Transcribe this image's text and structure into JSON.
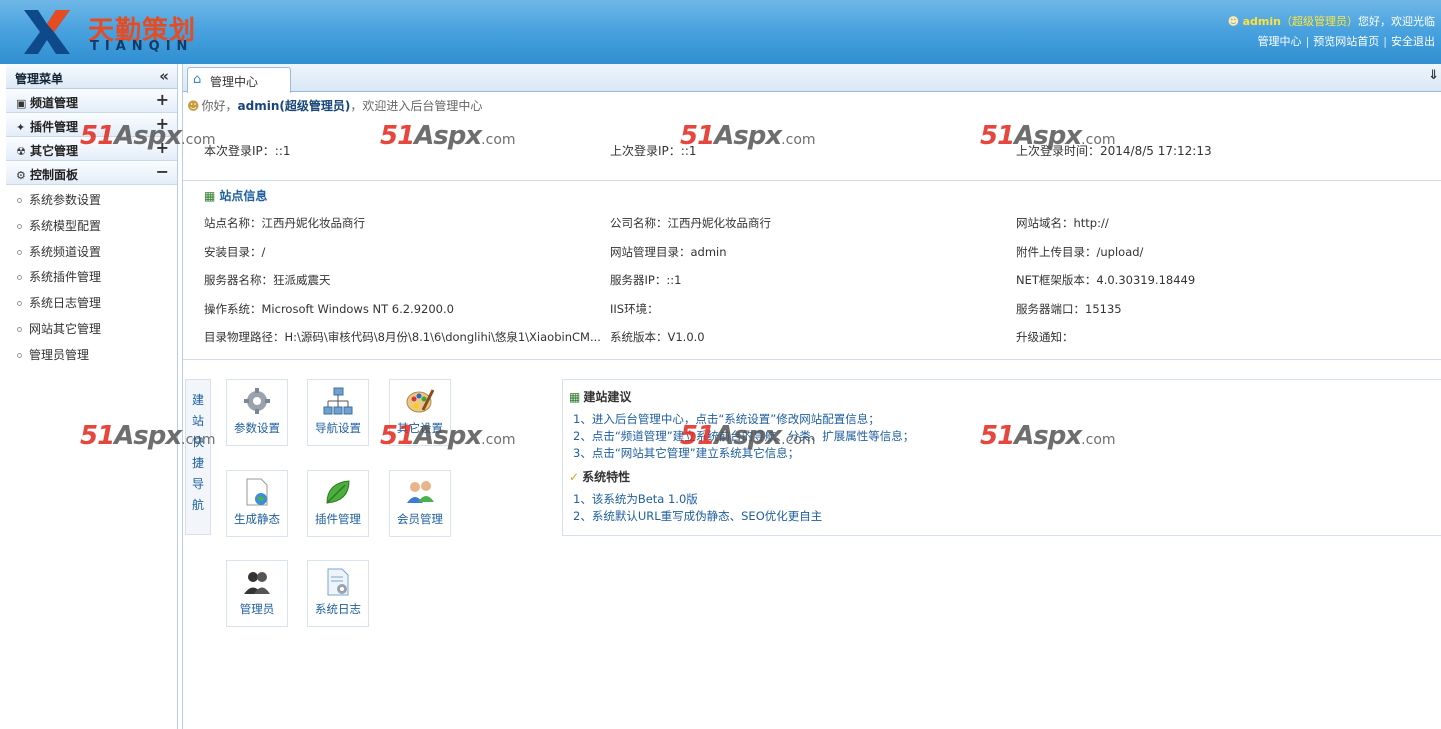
{
  "header": {
    "logo_cn": "天勤策划",
    "logo_en": "TIANQIN",
    "user_name": "admin",
    "user_role": "（超级管理员）",
    "greeting": "您好，欢迎光临",
    "links": [
      "管理中心",
      "预览网站首页",
      "安全退出"
    ]
  },
  "sidebar": {
    "title": "管理菜单",
    "collapse_icon": "«",
    "groups": [
      {
        "label": "频道管理",
        "toggle": "+"
      },
      {
        "label": "插件管理",
        "toggle": "+"
      },
      {
        "label": "其它管理",
        "toggle": "+"
      },
      {
        "label": "控制面板",
        "toggle": "−"
      }
    ],
    "items": [
      "系统参数设置",
      "系统模型配置",
      "系统频道设置",
      "系统插件管理",
      "系统日志管理",
      "网站其它管理",
      "管理员管理"
    ]
  },
  "main": {
    "tab": "管理中心",
    "welcome": {
      "prefix": "你好，",
      "user": "admin(超级管理员)",
      "suffix": "，欢迎进入后台管理中心"
    },
    "login": [
      "本次登录IP：::1",
      "上次登录IP：::1",
      "上次登录时间：2014/8/5 17:12:13"
    ],
    "site_info_title": "站点信息",
    "site_info": [
      [
        "站点名称：江西丹妮化妆品商行",
        "公司名称：江西丹妮化妆品商行",
        "网站域名：http://"
      ],
      [
        "安装目录：/",
        "网站管理目录：admin",
        "附件上传目录：/upload/"
      ],
      [
        "服务器名称：狂派威震天",
        "服务器IP：::1",
        "NET框架版本：4.0.30319.18449"
      ],
      [
        "操作系统：Microsoft Windows NT 6.2.9200.0",
        "IIS环境：",
        "服务器端口：15135"
      ],
      [
        "目录物理路径：H:\\源码\\审核代码\\8月份\\8.1\\6\\donglihi\\悠泉1\\XiaobinCM...",
        "系统版本：V1.0.0",
        "升级通知："
      ]
    ],
    "quick_nav_title": "建站快捷导航",
    "tiles": [
      "参数设置",
      "导航设置",
      "其它设置",
      "生成静态",
      "插件管理",
      "会员管理",
      "管理员",
      "系统日志"
    ],
    "advice_title": "建站建议",
    "advice": [
      "1、进入后台管理中心，点击“系统设置”修改网站配置信息；",
      "2、点击“频道管理”建立系统前台的导航、分类、扩展属性等信息；",
      "3、点击“网站其它管理”建立系统其它信息；"
    ],
    "features_title": "系统特性",
    "features": [
      "1、该系统为Beta 1.0版",
      "2、系统默认URL重写成伪静态、SEO优化更自主"
    ]
  },
  "watermark": {
    "num": "51",
    "aspx": "Aspx",
    "com": ".com"
  }
}
